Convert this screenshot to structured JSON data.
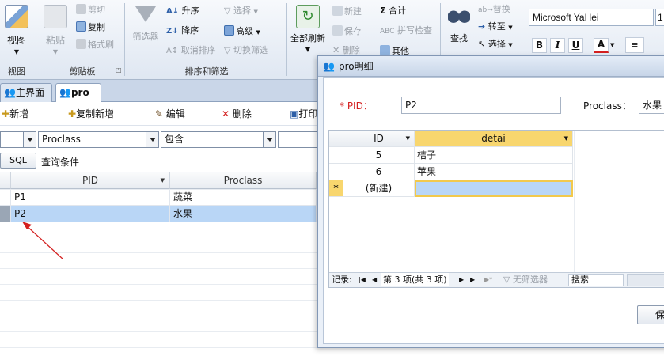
{
  "colors": {
    "accent": "#f8d66e",
    "selection": "#b9d6f6",
    "required": "#d42020",
    "arrow": "#d42020"
  },
  "ribbon": {
    "view": {
      "label": "视图",
      "group": "视图"
    },
    "clipboard": {
      "paste": "粘贴",
      "cut": "剪切",
      "copy": "复制",
      "format_painter": "格式刷",
      "group": "剪贴板"
    },
    "sort_filter": {
      "filter": "筛选器",
      "ascending": "升序",
      "descending": "降序",
      "clear_sort": "取消排序",
      "selection": "选择",
      "advanced": "高级",
      "toggle_filter": "切换筛选",
      "group": "排序和筛选"
    },
    "records": {
      "refresh_all": "全部刷新",
      "new": "新建",
      "save": "保存",
      "delete": "删除",
      "totals": "合计",
      "spelling": "拼写检查",
      "more": "其他"
    },
    "find": {
      "find": "查找",
      "replace": "替换",
      "goto": "转至",
      "select": "选择"
    },
    "text": {
      "font": "Microsoft YaHei",
      "size": "1",
      "bold": "B",
      "italic": "I",
      "underline": "U",
      "font_color": "A"
    }
  },
  "tabs": [
    {
      "label": "主界面"
    },
    {
      "label": "pro"
    }
  ],
  "toolbar": {
    "new": "新增",
    "copy_new": "复制新增",
    "edit": "编辑",
    "delete": "删除",
    "print": "打印"
  },
  "filter": {
    "field": "Proclass",
    "operator": "包含",
    "value": "",
    "sql_button": "SQL",
    "query_label": "查询条件"
  },
  "main_grid": {
    "columns": [
      "PID",
      "Proclass"
    ],
    "rows": [
      {
        "pid": "P1",
        "proclass": "蔬菜"
      },
      {
        "pid": "P2",
        "proclass": "水果"
      }
    ]
  },
  "dialog": {
    "title": "pro明细",
    "pid_label": "* PID：",
    "pid_value": "P2",
    "proclass_label": "Proclass：",
    "proclass_value": "水果",
    "subgrid": {
      "columns": [
        "ID",
        "detai"
      ],
      "rows": [
        {
          "id": "5",
          "detai": "桔子"
        },
        {
          "id": "6",
          "detai": "苹果"
        }
      ],
      "new_row_marker": "*",
      "new_row_label": "(新建)"
    },
    "nav": {
      "records_label": "记录:",
      "position": "第 3 项(共 3 项)",
      "filter_label": "无筛选器",
      "search": "搜索"
    },
    "save_button": "保"
  }
}
